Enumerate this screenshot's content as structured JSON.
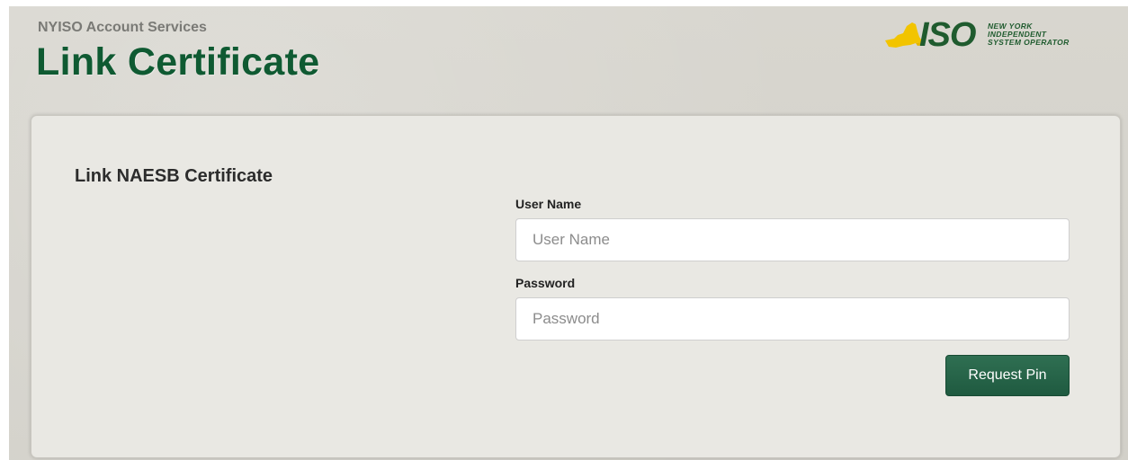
{
  "header": {
    "subtitle": "NYISO Account Services",
    "title": "Link Certificate"
  },
  "logo": {
    "mark": "ISO",
    "line1": "NEW YORK",
    "line2": "INDEPENDENT",
    "line3": "SYSTEM OPERATOR",
    "state_color": "#f2c400",
    "text_color": "#1f5b2e"
  },
  "panel": {
    "title": "Link NAESB Certificate"
  },
  "form": {
    "username": {
      "label": "User Name",
      "placeholder": "User Name",
      "value": ""
    },
    "password": {
      "label": "Password",
      "placeholder": "Password",
      "value": ""
    },
    "submit_label": "Request Pin"
  },
  "colors": {
    "title_green": "#0f5a32",
    "button_green": "#2f6f52"
  }
}
